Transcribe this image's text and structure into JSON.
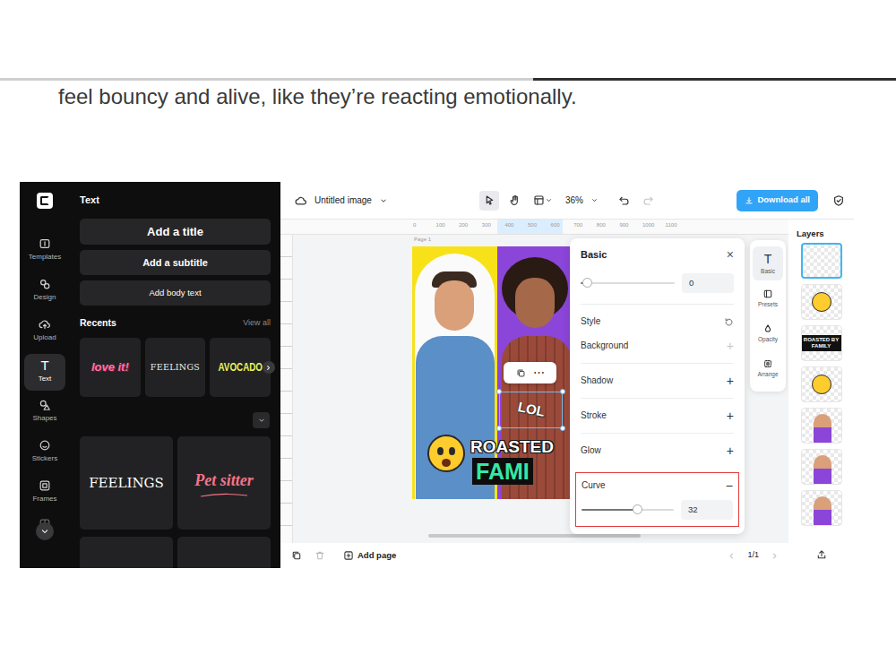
{
  "article": {
    "text": "feel bouncy and alive, like they’re reacting emotionally.",
    "read_progress": 0.595
  },
  "rail": {
    "items": [
      {
        "label": "Templates",
        "selected": false
      },
      {
        "label": "Design",
        "selected": false
      },
      {
        "label": "Upload",
        "selected": false
      },
      {
        "label": "Text",
        "icon": "T",
        "selected": true
      },
      {
        "label": "Shapes",
        "selected": false
      },
      {
        "label": "Stickers",
        "selected": false
      },
      {
        "label": "Frames",
        "selected": false
      }
    ]
  },
  "text_panel": {
    "title": "Text",
    "add_buttons": [
      "Add a title",
      "Add a subtitle",
      "Add body text"
    ],
    "recents_title": "Recents",
    "view_all": "View all",
    "recents": [
      "love it!",
      "FEELINGS",
      "AVOCADO"
    ],
    "featured": [
      "FEELINGS",
      "Pet sitter"
    ]
  },
  "topbar": {
    "file_name": "Untitled image",
    "zoom": "36%",
    "download": "Download all",
    "tools": [
      {
        "selected": true
      },
      {
        "selected": false
      }
    ],
    "redo_disabled": true
  },
  "canvas": {
    "ruler": [
      "0",
      "100",
      "200",
      "300",
      "400",
      "500",
      "600",
      "700",
      "800",
      "900",
      "1000",
      "1100"
    ],
    "page_label": "Page 1",
    "more": "⋯",
    "texts": {
      "curved": "LOL",
      "line1": "ROASTED",
      "line2": "FAMI"
    }
  },
  "properties": {
    "title": "Basic",
    "close": "×",
    "spacing": {
      "value": "0",
      "level": 0.07
    },
    "rows": [
      {
        "label": "Style",
        "kind": "reset"
      },
      {
        "label": "Background",
        "kind": "add",
        "action": "+",
        "disabled": true
      },
      {
        "label": "Shadow",
        "kind": "add",
        "action": "+",
        "disabled": false
      },
      {
        "label": "Stroke",
        "kind": "add",
        "action": "+",
        "disabled": false
      },
      {
        "label": "Glow",
        "kind": "add",
        "action": "+",
        "disabled": false
      },
      {
        "label": "Curve",
        "kind": "slider",
        "action": "−",
        "value": "32",
        "level": 0.6,
        "highlighted": true
      }
    ]
  },
  "side_tabs": [
    {
      "label": "Basic",
      "icon": "T",
      "selected": true
    },
    {
      "label": "Presets",
      "selected": false
    },
    {
      "label": "Opacity",
      "selected": false
    },
    {
      "label": "Arrange",
      "selected": false
    }
  ],
  "layers": {
    "title": "Layers",
    "items": [
      {
        "kind": "blank",
        "selected": true
      },
      {
        "kind": "emoji",
        "selected": false
      },
      {
        "kind": "text",
        "text": "ROASTED BY FAMILY",
        "selected": false
      },
      {
        "kind": "emoji",
        "selected": false
      },
      {
        "kind": "photo",
        "selected": false
      },
      {
        "kind": "photo",
        "selected": false
      },
      {
        "kind": "photo",
        "selected": false
      }
    ]
  },
  "bottom_bar": {
    "add_page": "Add page",
    "page_count": "1/1",
    "prev_disabled": true
  }
}
